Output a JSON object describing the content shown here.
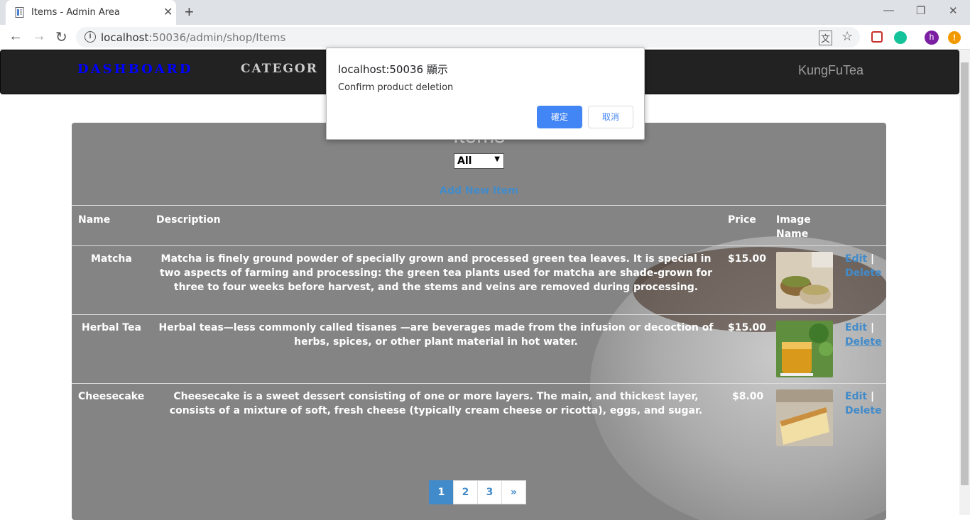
{
  "browser": {
    "tab_title": "Items - Admin Area",
    "tab_close": "✕",
    "new_tab": "+",
    "url_host": "localhost",
    "url_rest": ":50036/admin/shop/Items",
    "back": "←",
    "forward": "→",
    "reload": "↻",
    "minimize": "—",
    "restore": "❐",
    "close": "✕",
    "info": "i",
    "translate": "文",
    "bookmark": "☆",
    "profile_initial": "h",
    "ext_alert": "!"
  },
  "navbar": {
    "dashboard": "DASHBOARD",
    "categories": "CATEGOR",
    "brand": "KungFuTea"
  },
  "panel": {
    "title": "Items",
    "filter_value": "All",
    "filter_arrow": "▼",
    "add_new": "Add New Item",
    "headers": {
      "name": "Name",
      "description": "Description",
      "price": "Price",
      "image_line1": "Image",
      "image_line2": "Name"
    },
    "rows": [
      {
        "name": "Matcha",
        "description": "Matcha is finely ground powder of specially grown and processed green tea leaves. It is special in two aspects of farming and processing: the green tea plants used for matcha are shade-grown for three to four weeks before harvest, and the stems and veins are removed during processing.",
        "price": "$15.00",
        "edit": "Edit",
        "sep": "|",
        "delete": "Delete"
      },
      {
        "name": "Herbal Tea",
        "description": "Herbal teas—less commonly called tisanes —are beverages made from the infusion or decoction of herbs, spices, or other plant material in hot water.",
        "price": "$15.00",
        "edit": "Edit",
        "sep": "|",
        "delete": "Delete"
      },
      {
        "name": "Cheesecake",
        "description": "Cheesecake is a sweet dessert consisting of one or more layers. The main, and thickest layer, consists of a mixture of soft, fresh cheese (typically cream cheese or ricotta), eggs, and sugar.",
        "price": "$8.00",
        "edit": "Edit",
        "sep": "|",
        "delete": "Delete"
      }
    ],
    "pagination": [
      "1",
      "2",
      "3",
      "»"
    ],
    "active_page": "1"
  },
  "dialog": {
    "title": "localhost:50036 顯示",
    "message": "Confirm product deletion",
    "ok": "確定",
    "cancel": "取消"
  },
  "colors": {
    "accent": "#428bca",
    "dialog_ok": "#4285f4",
    "navbar_bg": "#222222",
    "panel_bg": "#848484",
    "dashboard_link": "#0000ff"
  }
}
